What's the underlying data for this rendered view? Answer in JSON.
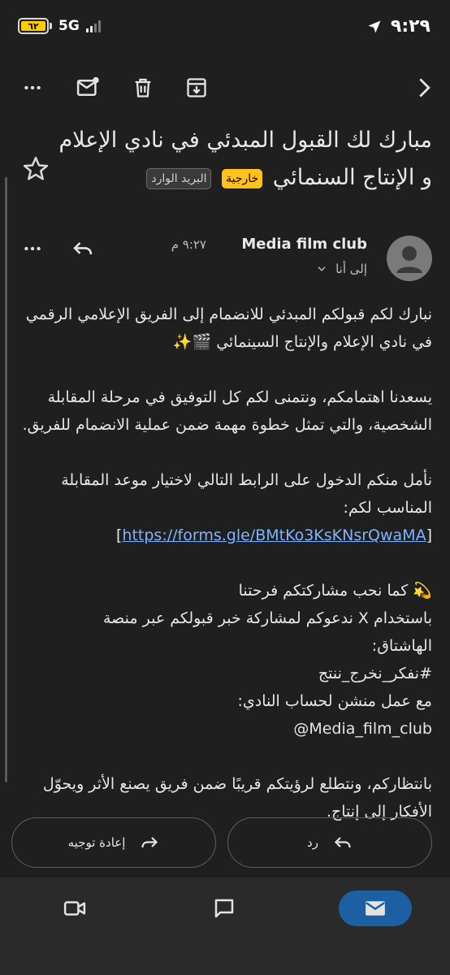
{
  "status": {
    "battery": "٦٢",
    "network": "5G",
    "time": "٩:٢٩"
  },
  "toolbar": {
    "icons": [
      "more-icon",
      "mark-unread-icon",
      "delete-icon",
      "archive-icon",
      "next-icon"
    ]
  },
  "subject": {
    "text": "مبارك لك القبول المبدئي في نادي الإعلام و الإنتاج السنمائي",
    "labels": [
      "خارجية",
      "البريد الوارد"
    ]
  },
  "message": {
    "sender": "Media film club",
    "time": "٩:٢٧ م",
    "recipient": "إلى أنا",
    "body": {
      "p1": "نبارك لكم قبولكم المبدئي للانضمام إلى الفريق الإعلامي الرقمي في نادي الإعلام والإنتاج السينمائي 🎬✨",
      "p2": "يسعدنا اهتمامكم، ونتمنى لكم كل التوفيق في مرحلة المقابلة الشخصية، والتي تمثل خطوة مهمة ضمن عملية الانضمام للفريق.",
      "p3": "نأمل منكم الدخول على الرابط التالي لاختيار موعد المقابلة المناسب لكم:",
      "link": "https://forms.gle/BMtKo3KsKNsrQwaMA",
      "p4_line1": "💫 كما نحب مشاركتكم فرحتنا",
      "p4_line2": "باستخدام X ندعوكم لمشاركة خبر قبولكم عبر منصة",
      "p4_line3": "الهاشتاق:",
      "p4_hashtag": "#نفكر_نخرج_ننتج",
      "p4_line4": "مع عمل منشن لحساب النادي:",
      "p4_mention": "@Media_film_club",
      "p5": "بانتظاركم، ونتطلع لرؤيتكم قريبًا ضمن فريق يصنع الأثر ويحوّل الأفكار إلى إنتاج."
    }
  },
  "actions": {
    "reply": "رد",
    "forward": "إعادة توجيه"
  },
  "colors": {
    "background": "#1f1f1f",
    "link": "#7fb3ff",
    "external_chip": "#ffc21a",
    "nav_active": "#1d5fa3"
  }
}
